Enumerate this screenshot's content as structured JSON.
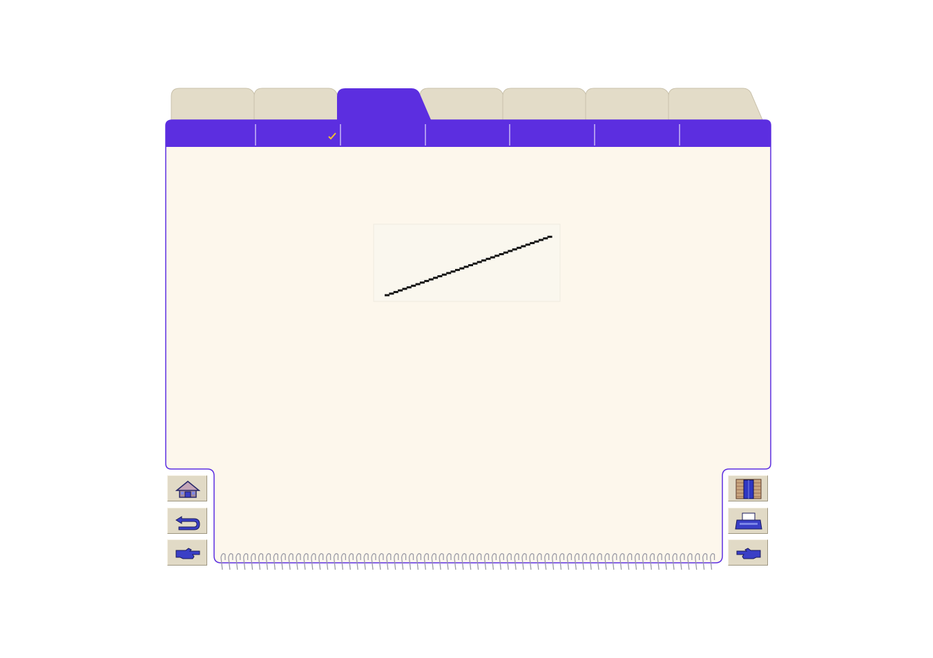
{
  "tabs": [
    {
      "id": "tab-1",
      "label": "",
      "active": false
    },
    {
      "id": "tab-2",
      "label": "",
      "active": false
    },
    {
      "id": "tab-3",
      "label": "",
      "active": true
    },
    {
      "id": "tab-4",
      "label": "",
      "active": false
    },
    {
      "id": "tab-5",
      "label": "",
      "active": false
    },
    {
      "id": "tab-6",
      "label": "",
      "active": false
    },
    {
      "id": "tab-7",
      "label": "",
      "active": false
    }
  ],
  "subtabs": [
    {
      "label": "",
      "checked": false
    },
    {
      "label": "",
      "checked": true
    },
    {
      "label": "",
      "checked": false
    },
    {
      "label": "",
      "checked": false
    },
    {
      "label": "",
      "checked": false
    },
    {
      "label": "",
      "checked": false
    },
    {
      "label": "",
      "checked": false
    }
  ],
  "nav_left": [
    "home-icon",
    "back-arrow-icon",
    "next-hand-icon"
  ],
  "nav_right": [
    "exit-door-icon",
    "printer-icon",
    "previous-hand-icon"
  ],
  "colors": {
    "active_tab": "#5c2ee0",
    "inactive_tab": "#e3dcc8",
    "page_background": "#fdf7ec",
    "button_face": "#e1dac6",
    "checkmark": "#f0c030"
  }
}
